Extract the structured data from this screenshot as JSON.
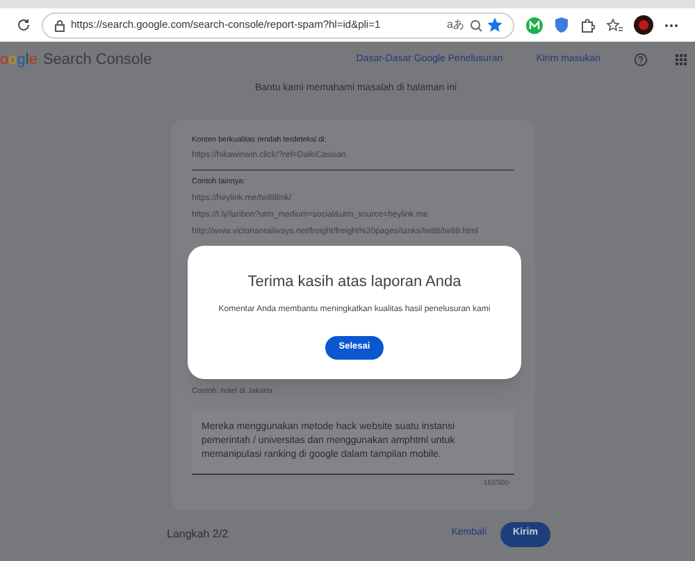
{
  "browser": {
    "url": "https://search.google.com/search-console/report-spam?hl=id&pli=1",
    "translate_glyph": "aあ",
    "bookmarked": true
  },
  "header": {
    "logo_visible": "oogle",
    "product": "Search Console",
    "links": [
      "Dasar-Dasar Google Penelusuran",
      "Kirim masukan"
    ]
  },
  "page": {
    "subtitle": "Bantu kami memahami masalah di halaman ini",
    "detected": {
      "label": "Konten berkualitas rendah terdeteksi di:",
      "url": "https://hikawinwin.click/?ref=DaikiCassian"
    },
    "examples": {
      "label": "Contoh lainnya:",
      "urls": [
        "https://heylink.me/tw88link/",
        "https://t.ly/laribon?utm_medium=social&utm_source=heylink.me",
        "http://www.victorianrailways.net/freight/freight%20pages/tanks/tw88/tw88.html"
      ]
    },
    "query_hint": "Contoh: hotel di Jakarta",
    "comment": {
      "value": "Mereka menggunakan metode hack website suatu instansi pemerintah / universitas dan menggunakan amphtml untuk memanipulasi ranking di google dalam tampilan mobile.",
      "counter": "162/300"
    },
    "step": "Langkah 2/2",
    "back": "Kembali",
    "submit": "Kirim"
  },
  "dialog": {
    "title": "Terima kasih atas laporan Anda",
    "message": "Komentar Anda membantu meningkatkan kualitas hasil penelusuran kami",
    "button": "Selesai"
  }
}
